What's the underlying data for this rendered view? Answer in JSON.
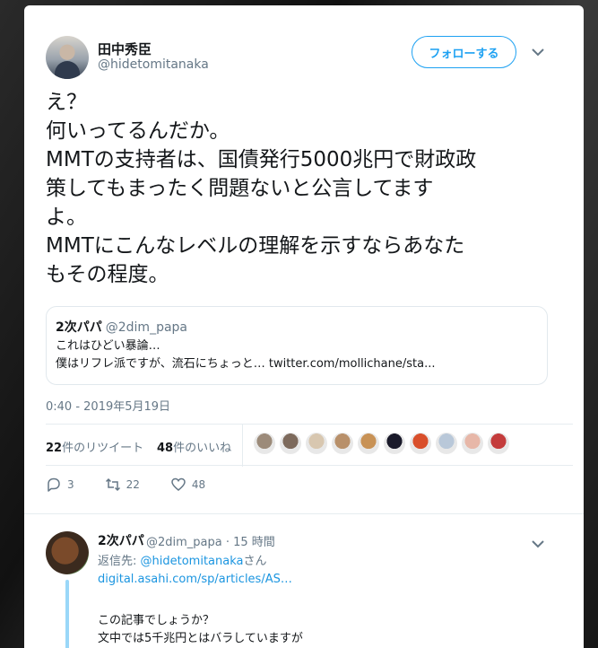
{
  "tweet": {
    "display_name": "田中秀臣",
    "handle": "@hidetomitanaka",
    "follow_label": "フォローする",
    "text": "え？\n何いってるんだか。\nMMTの支持者は、国債発行5000兆円で財政政\n策してもまったく問題ないと公言してます\nよ。\nMMTにこんなレベルの理解を示すならあなた\nもその程度。",
    "timestamp": "0:40 - 2019年5月19日"
  },
  "quote": {
    "name": "2次パパ",
    "handle": "@2dim_papa",
    "line1": "これはひどい暴論…",
    "line2": "僕はリフレ派ですが、流石にちょっと… twitter.com/mollichane/sta..."
  },
  "stats": {
    "retweets_count": "22",
    "retweets_label": "件のリツイート",
    "likes_count": "48",
    "likes_label": "件のいいね",
    "liker_colors": [
      "#9c8b7a",
      "#7d6a5c",
      "#d8c7b0",
      "#b8906a",
      "#c89256",
      "#1a1a2a",
      "#d94f2b",
      "#b9c8d9",
      "#e7b7a8",
      "#c43c3c"
    ]
  },
  "actions": {
    "reply_count": "3",
    "retweet_count": "22",
    "like_count": "48"
  },
  "reply": {
    "name": "2次パパ",
    "meta": "@2dim_papa · 15 時間",
    "replyto_prefix": "返信先: ",
    "replyto_handle": "@hidetomitanaka",
    "replyto_suffix": "さん",
    "link": "digital.asahi.com/sp/articles/AS…",
    "line1": "この記事でしょうか？",
    "line2": "文中では5千兆円とはバラしていますが"
  },
  "colors": {
    "accent": "#1da1f2",
    "muted": "#657786",
    "link": "#1b95e0"
  }
}
